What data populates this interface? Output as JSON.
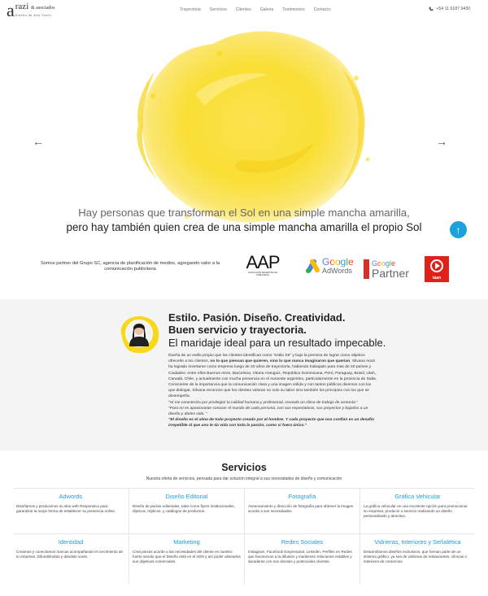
{
  "header": {
    "logo_a": "a",
    "logo_name": "razi",
    "logo_suffix": "& asociados",
    "logo_tagline": "Diseño de Alto Vuelo",
    "nav": [
      "Trayectoria",
      "Servicios",
      "Clientes",
      "Galeria",
      "Testimonios",
      "Contacto"
    ],
    "phone": "+54 11 6187 0430"
  },
  "hero": {
    "tagline_1": "Hay personas que transforman el Sol en una simple mancha amarilla,",
    "tagline_2": "pero hay también quien crea de una simple mancha amarilla el propio Sol",
    "prev_icon": "chevron-left-icon",
    "next_icon": "chevron-right-icon",
    "accent": "#f8d81c"
  },
  "partners": {
    "text": "Somos partner del Grupo SC, agencia de planificación de medios, agregando valor a la comunicación publicitaria",
    "aap_logo": "AAP",
    "aap_sub": "ASOCIACIÓN ARGENTINA DE PUBLICIDAD",
    "adwords_google": "Google",
    "adwords_label": "AdWords",
    "partner_google": "Google",
    "partner_label": "Partner",
    "taan_label": "taan"
  },
  "about": {
    "heading": "Estilo. Pasión. Diseño. Creatividad. Buen servicio y trayectoria.",
    "subheading": "El maridaje ideal para un resultado impecable.",
    "para_1a": "Dueña de un estilo propio que los clientes identifican como \"estilo SII\" y bajo la premisa de lograr como objetivo ofrecerle a los clientes, ",
    "para_1b": "no lo que piensan que quieren, sino lo que nunca imaginaron que querían",
    "para_1c": ", Silvana Arazi ha logrado insertarse como empresa luego de 20 años de trayectoria, habiendo trabajado para mas de 20 países y Ciudades: entre ellos Buenos Aires, Barcelona, Vitoria Aranguiz, Republica Dominicana, Perú, Paraguay, Brasil, Utah, Canadá, Chile, y actualmente con mucha presencia en el noroeste argentino, particularmente en la provincia de Salta. Consciente de la importancia que la comunicación clara y una imagen sólida y con tantos públicos diversos con los que dialogar, Silvana reconoce que los clientes valoran no solo su labor sino también los principios con los que se desempeña.",
    "quote_1": "\"Hi me caracterizo por privilegiar la calidad humana y profesional, creando un clima de trabajo de armonía.\"",
    "quote_2": "\"Para mi es apasionante conocer el mundo de cada persona, con sus expectativas, sus proyectos y bajarlos a un diseño y darles vida. \"",
    "quote_3": "\"El diseño es el alma de todo proyecto creado por el hombre. Y cada proyecto que nos confían es un desafío irrepetible al que uno le da vida con toda la pasión, como si fuera único.\""
  },
  "services": {
    "title": "Servicios",
    "subtitle": "Nuestra oferta de servicios, pensada para dar solución integral a sus necesidades de diseño y comunicación",
    "items": [
      {
        "name": "Adwords",
        "desc": "Diseñamos y producimos su sitio web Responsivo para garantizar la mejor forma de establecer su presencia online."
      },
      {
        "name": "Diseño Editorial",
        "desc": "Diseño de piezas editoriales, tales como flyers institucionales, dípticos, trípticos, y catálogos de productos."
      },
      {
        "name": "Fotografía",
        "desc": "Asesoramiento y dirección de fotografía para obtener la imagen acorde a sus necesidades."
      },
      {
        "name": "Gráfica Vehicular",
        "desc": "La gráfica vehicular es una excelente opción para promocionar su empresa, producto o servicio realizando un diseño personalizado y atractivo."
      },
      {
        "name": "Identidad",
        "desc": "Creamos y conectamos marcas acompañando el crecimiento de tu empresa. Difundiéndola y dándole vuelo."
      },
      {
        "name": "Marketing",
        "desc": "Creá piezas acorde a las necesidades del cliente es nuestro fuerte siendo que el Diseño está en el ADN y así poder alinearlos sus objetivos comerciales."
      },
      {
        "name": "Redes Sociales",
        "desc": "Instagram, Facebook Empresarial, LinkedIn. Perfiles en Redes que favorezcan a la difusión y mantienen relaciones estables y duraderas con sus clientes y potenciales clientes."
      },
      {
        "name": "Vidrieras, Interiores y Señalética",
        "desc": "Desarrollamos diseños exclusivos, que forman parte de un sistema gráfico, ya sea de vidrieras de restaurantes, clínicas o interiores de comercios."
      }
    ],
    "accent": "#1ba1dc"
  }
}
